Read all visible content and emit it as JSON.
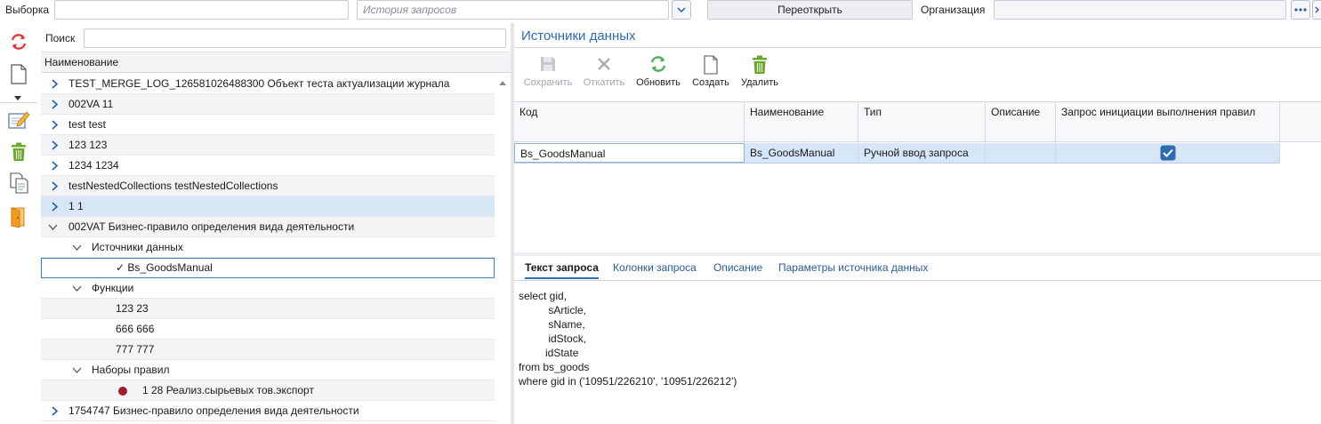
{
  "topbar": {
    "vyborka_label": "Выборка",
    "vyborka_value": "",
    "history_placeholder": "История запросов",
    "reopen_label": "Переоткрыть",
    "org_label": "Организация",
    "org_value": ""
  },
  "left_toolbar": {
    "icons": [
      "refresh-icon",
      "new-document-icon",
      "dropdown-arrow-icon",
      "edit-icon",
      "trash-icon",
      "copy-icon",
      "exit-door-icon"
    ]
  },
  "search": {
    "label": "Поиск",
    "value": ""
  },
  "tree": {
    "header": "Наименование",
    "rows": [
      {
        "text": "TEST_MERGE_LOG_126581026488300 Объект теста актуализации журнала",
        "level": 0,
        "expander": "collapsed"
      },
      {
        "text": "002VA 11",
        "level": 0,
        "expander": "collapsed"
      },
      {
        "text": "test test",
        "level": 0,
        "expander": "collapsed"
      },
      {
        "text": "123 123",
        "level": 0,
        "expander": "collapsed"
      },
      {
        "text": "1234 1234",
        "level": 0,
        "expander": "collapsed"
      },
      {
        "text": "testNestedCollections testNestedCollections",
        "level": 0,
        "expander": "collapsed"
      },
      {
        "text": "1 1",
        "level": 0,
        "expander": "collapsed"
      },
      {
        "text": "002VAT Бизнес-правило определения вида деятельности",
        "level": 0,
        "expander": "expanded"
      },
      {
        "text": "Источники данных",
        "level": 1,
        "expander": "expanded"
      },
      {
        "text": "✓ Bs_GoodsManual",
        "level": 2,
        "expander": "none"
      },
      {
        "text": "Функции",
        "level": 1,
        "expander": "expanded"
      },
      {
        "text": "123 23",
        "level": 2,
        "expander": "none"
      },
      {
        "text": "666 666",
        "level": 2,
        "expander": "none"
      },
      {
        "text": "777 777",
        "level": 2,
        "expander": "none"
      },
      {
        "text": "Наборы правил",
        "level": 1,
        "expander": "expanded"
      },
      {
        "text": "1 28 Реализ.сырьевых тов.экспорт",
        "level": 3,
        "expander": "dot"
      },
      {
        "text": "1754747 Бизнес-правило определения вида деятельности",
        "level": 0,
        "expander": "collapsed"
      }
    ]
  },
  "panel": {
    "title": "Источники данных",
    "toolbar": {
      "save": "Сохранить",
      "rollback": "Откатить",
      "refresh": "Обновить",
      "create": "Создать",
      "delete": "Удалить"
    },
    "grid": {
      "columns": [
        "Код",
        "Наименование",
        "Тип",
        "Описание",
        "Запрос инициации выполнения правил"
      ],
      "row": {
        "code": "Bs_GoodsManual",
        "name": "Bs_GoodsManual",
        "type": "Ручной ввод запроса",
        "description": "",
        "init_checked": true
      }
    },
    "tabs": [
      "Текст запроса",
      "Колонки запроса",
      "Описание",
      "Параметры источника данных"
    ],
    "active_tab": 0,
    "query_text": "select gid,\n          sArticle,\n          sName,\n          idStock,\n         idState\nfrom bs_goods\nwhere gid in ('10951/226210', '10951/226212')"
  },
  "colors": {
    "accent": "#2d6bb5",
    "selected_row": "#d6e6f7",
    "refresh_green": "#4caf50",
    "trash_green": "#6aaa2a",
    "bullet": "#a3182b",
    "checkbox": "#2d6bb5"
  }
}
